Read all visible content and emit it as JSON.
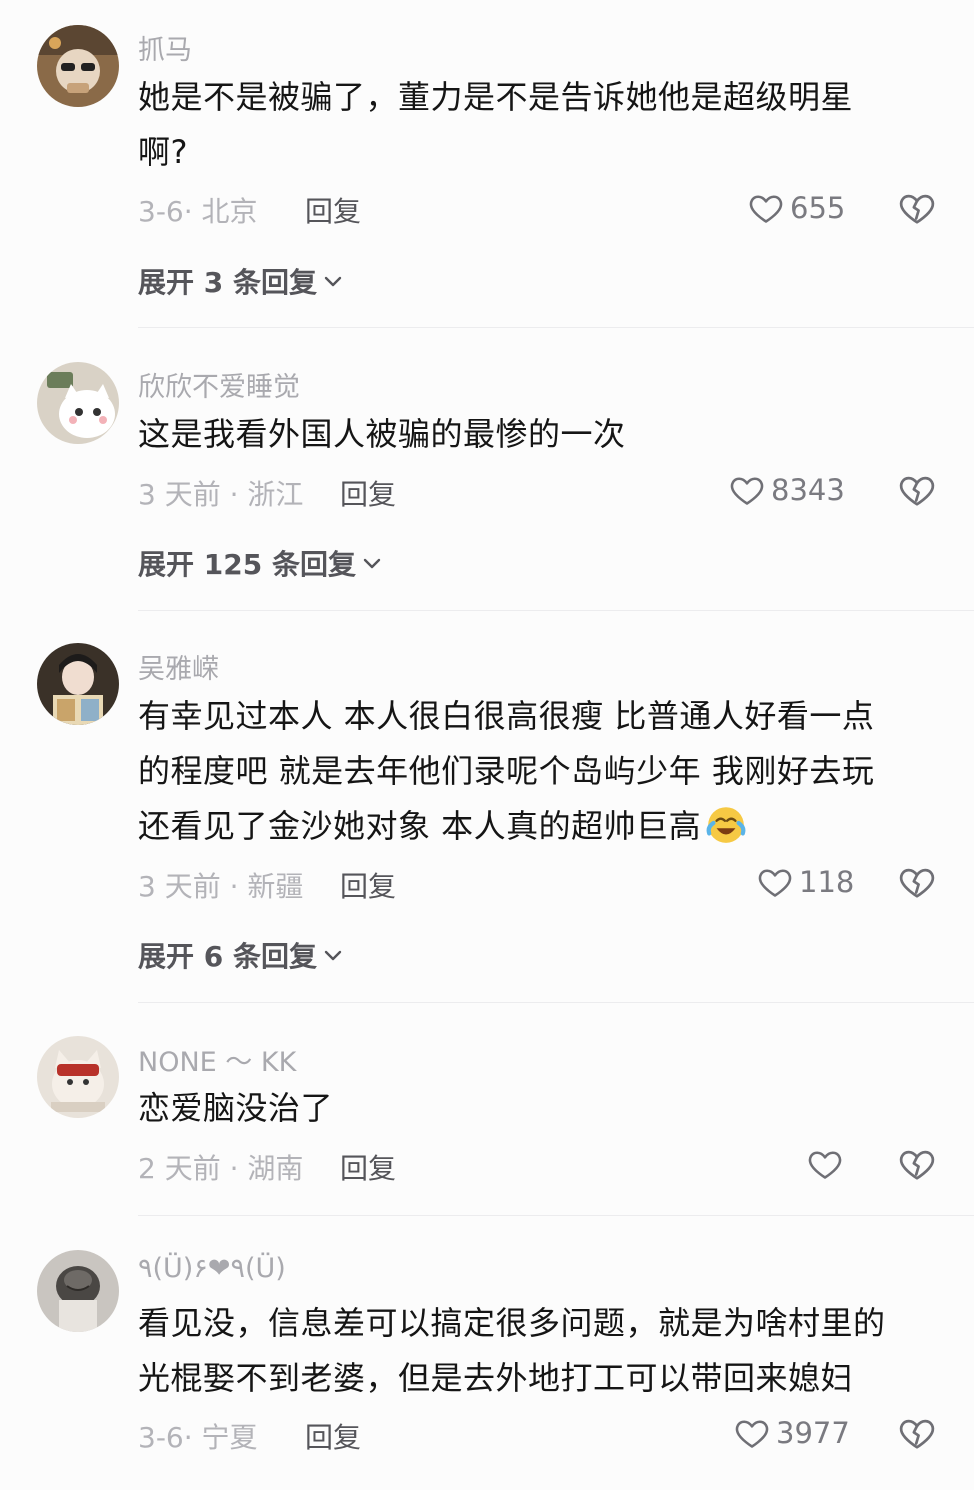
{
  "comments": [
    {
      "username": "抓马",
      "lines": [
        "她是不是被骗了，董力是不是告诉她他是超级明星",
        "啊?"
      ],
      "date_location": "3-6· 北京",
      "reply_label": "回复",
      "likes": "655",
      "expand_label": "展开 3 条回复"
    },
    {
      "username": "欣欣不爱睡觉",
      "lines": [
        "这是我看外国人被骗的最惨的一次"
      ],
      "date_location": "3 天前 · 浙江",
      "reply_label": "回复",
      "likes": "8343",
      "expand_label": "展开 125 条回复"
    },
    {
      "username": "吴雅嵘",
      "lines": [
        "有幸见过本人 本人很白很高很瘦 比普通人好看一点",
        "的程度吧 就是去年他们录呢个岛屿少年 我刚好去玩",
        "还看见了金沙她对象 本人真的超帅巨高"
      ],
      "date_location": "3 天前 · 新疆",
      "reply_label": "回复",
      "likes": "118",
      "expand_label": "展开 6 条回复",
      "emoji": "crying-laughing-emoji"
    },
    {
      "username": "NONE ～ KK",
      "lines": [
        "恋爱脑没治了"
      ],
      "date_location": "2 天前 · 湖南",
      "reply_label": "回复",
      "likes": ""
    },
    {
      "username": "٩(Ü)۶❤٩(Ü)",
      "lines": [
        "看见没，信息差可以搞定很多问题，就是为啥村里的",
        "光棍娶不到老婆，但是去外地打工可以带回来媳妇"
      ],
      "date_location": "3-6· 宁夏",
      "reply_label": "回复",
      "likes": "3977"
    }
  ],
  "icons": {
    "like": "heart-outline-icon",
    "dislike": "broken-heart-icon",
    "expand": "chevron-down-icon"
  },
  "colors": {
    "text": "#151515",
    "muted": "#a9a9ae",
    "icon": "#6f6f75"
  }
}
